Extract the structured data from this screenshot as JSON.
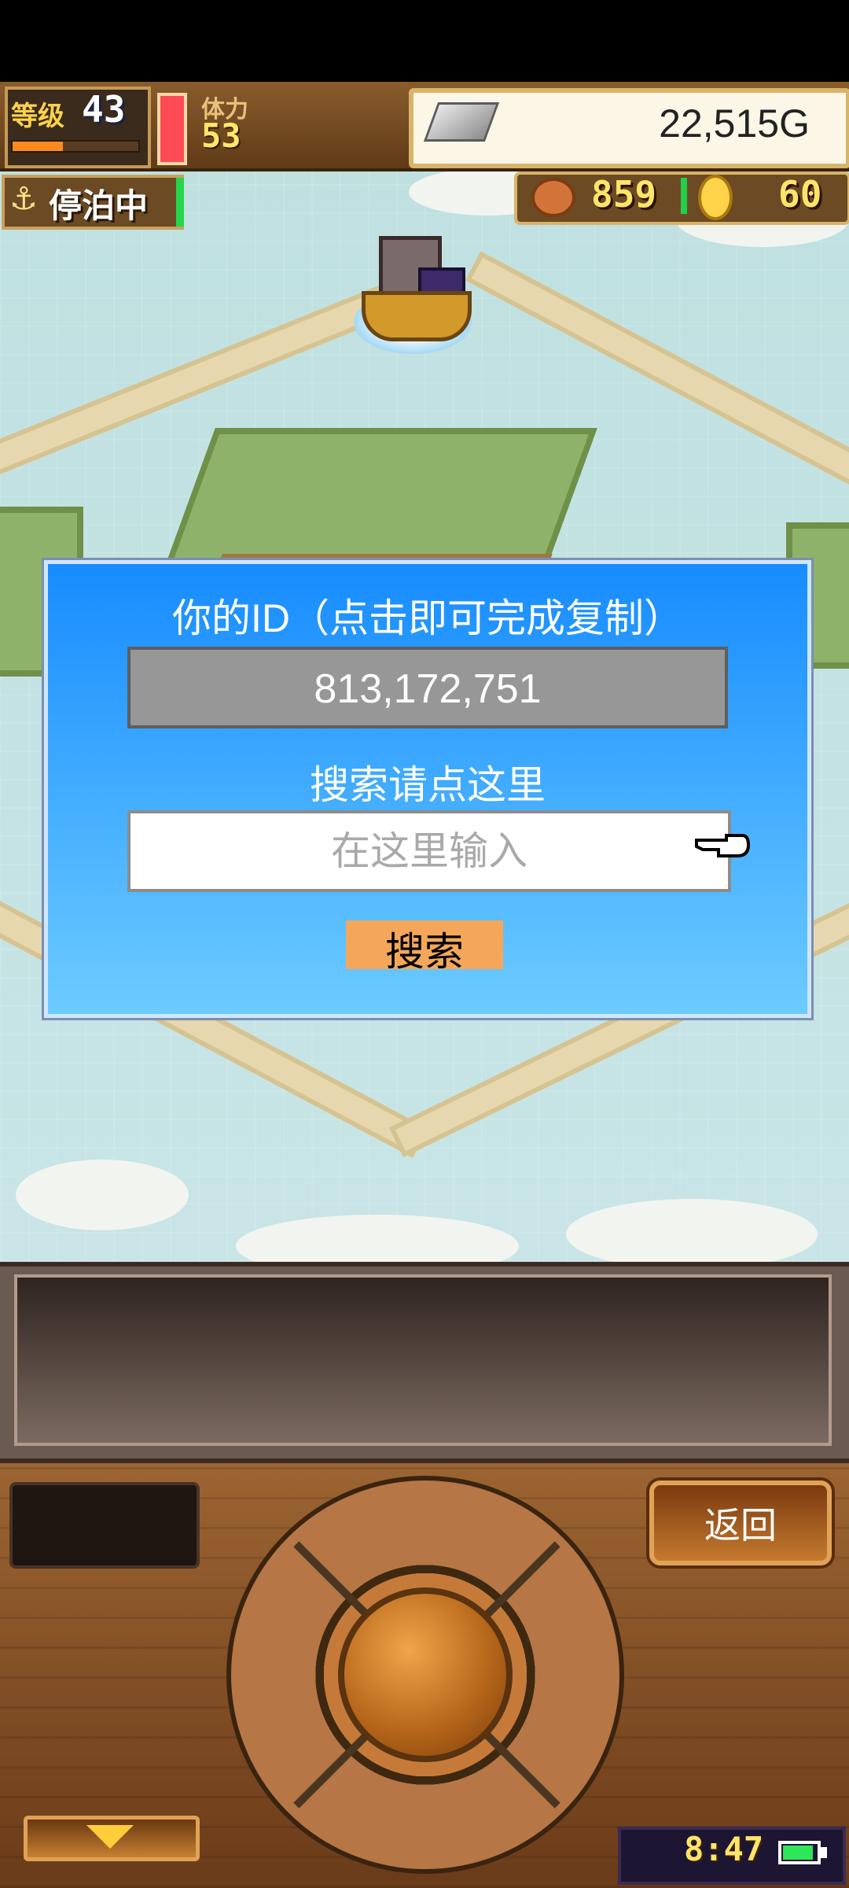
{
  "hud": {
    "level_label": "等级",
    "level_value": "43",
    "level_progress": 0.4,
    "stamina_label": "体力",
    "stamina_value": "53",
    "money": "22,515G",
    "status_label": "停泊中",
    "fish_count": "859",
    "coin_count": "60"
  },
  "dialog": {
    "id_title": "你的ID（点击即可完成复制）",
    "id_value": "813,172,751",
    "search_title": "搜索请点这里",
    "search_placeholder": "在这里输入",
    "search_value": "",
    "search_button": "搜索"
  },
  "controls": {
    "back_button": "返回",
    "clock": "8:47",
    "battery_level": 0.9
  },
  "colors": {
    "dialog_top": "#178cff",
    "dialog_bottom": "#6ccbff",
    "search_button": "#f4a75a",
    "id_box": "#979797"
  },
  "icons": [
    "anchor-icon",
    "silver-ingot-icon",
    "fish-icon",
    "coin-icon",
    "pointing-hand-icon",
    "down-arrow-icon",
    "battery-icon"
  ]
}
